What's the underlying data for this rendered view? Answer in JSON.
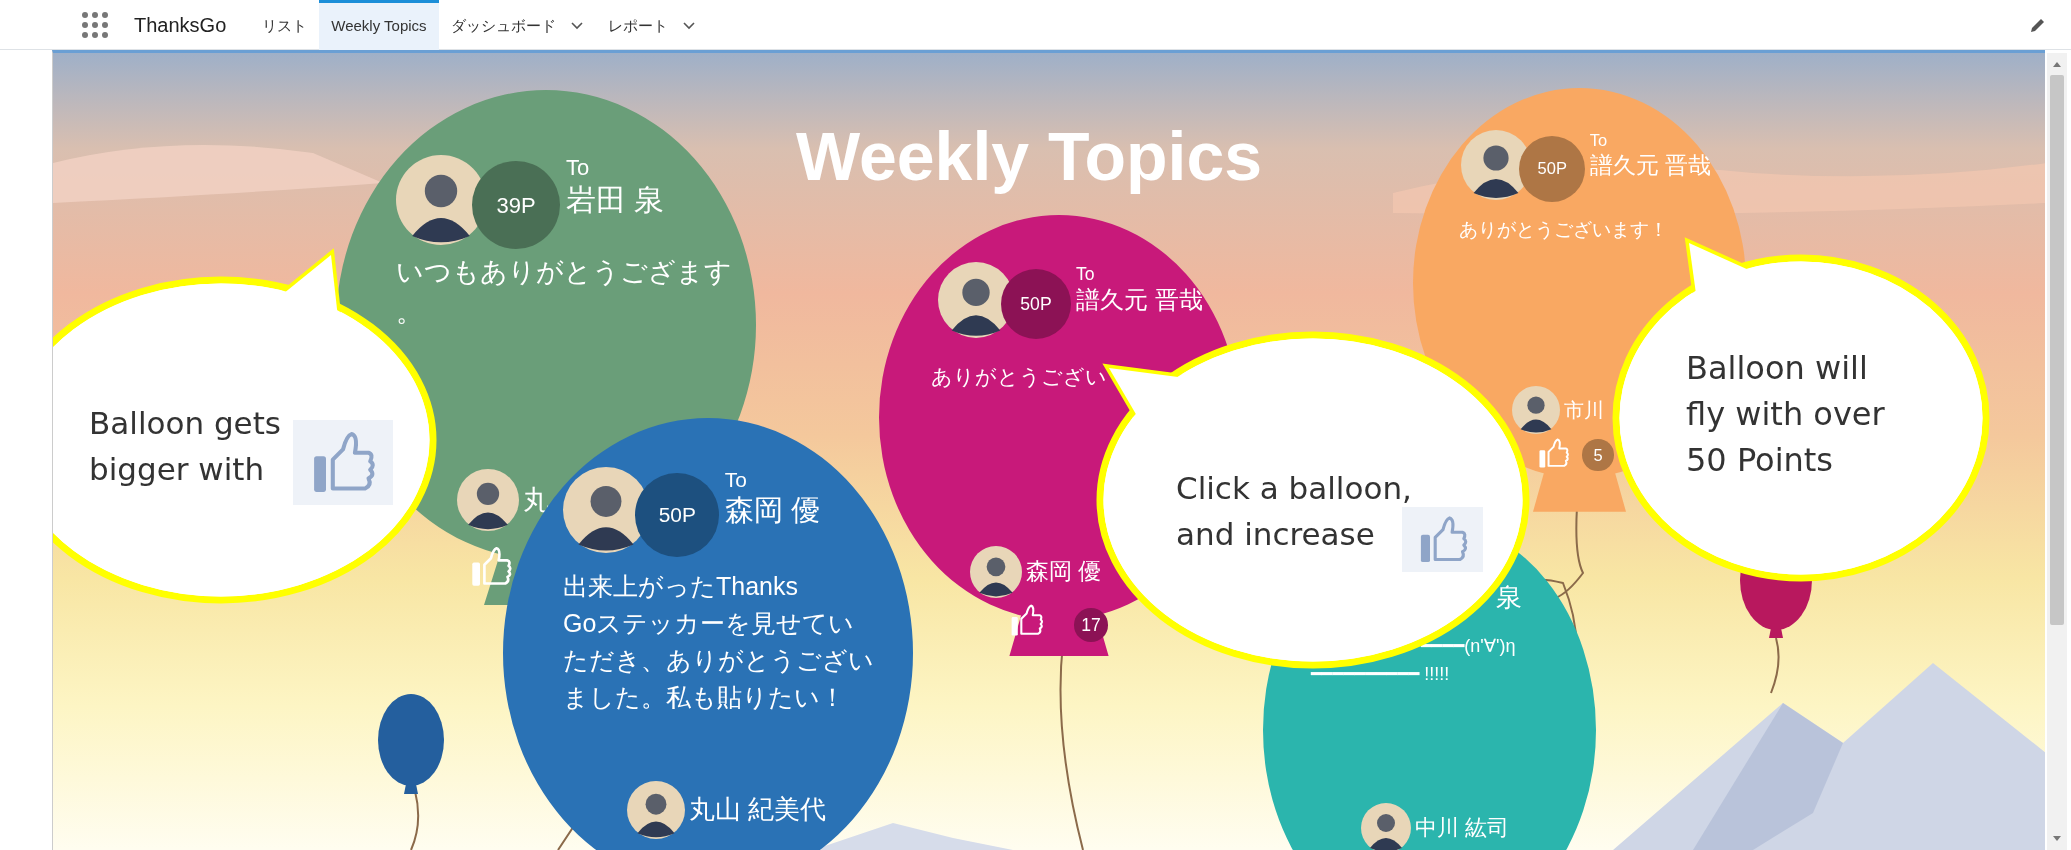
{
  "app_bar": {
    "app_name": "ThanksGo",
    "tabs": [
      {
        "label": "リスト",
        "selected": false,
        "has_menu": false
      },
      {
        "label": "Weekly Topics",
        "selected": true,
        "has_menu": false
      },
      {
        "label": "ダッシュボード",
        "selected": false,
        "has_menu": true
      },
      {
        "label": "レポート",
        "selected": false,
        "has_menu": true
      }
    ]
  },
  "page": {
    "title": "Weekly Topics",
    "balloons": [
      {
        "color": "#6a9e79",
        "to_label": "To",
        "recipient": "岩田 泉",
        "points": "39P",
        "message": [
          "いつもありがとうござます",
          "。"
        ],
        "sender": "丸"
      },
      {
        "color": "#c8197a",
        "to_label": "To",
        "recipient": "譜久元 晋哉",
        "points": "50P",
        "message": [
          "ありがとうござい"
        ],
        "sender": "森岡 優",
        "likes": "17"
      },
      {
        "color": "#f9a862",
        "to_label": "To",
        "recipient": "譜久元 晋哉",
        "points": "50P",
        "message": [
          "ありがとうございます！"
        ],
        "sender": "市川",
        "likes": "5"
      },
      {
        "color": "#2bb5ad",
        "recipient": "泉",
        "message": [
          "━━━━(n'∀')η",
          "━━━━━━━━━━ !!!!!"
        ],
        "sender": "中川 紘司"
      },
      {
        "color": "#2a72b5",
        "to_label": "To",
        "recipient": "森岡 優",
        "points": "50P",
        "message": [
          "出来上がったThanks",
          "Goステッカーを見せてい",
          "ただき、ありがとうござい",
          "ました。私も貼りたい！"
        ],
        "sender": "丸山 紀美代"
      }
    ],
    "callouts": [
      {
        "lines": [
          "Balloon gets",
          "bigger with"
        ]
      },
      {
        "lines": [
          "Click a balloon,",
          "and increase"
        ]
      },
      {
        "lines": [
          "Balloon will",
          "fly with over",
          "50 Points"
        ]
      }
    ]
  }
}
